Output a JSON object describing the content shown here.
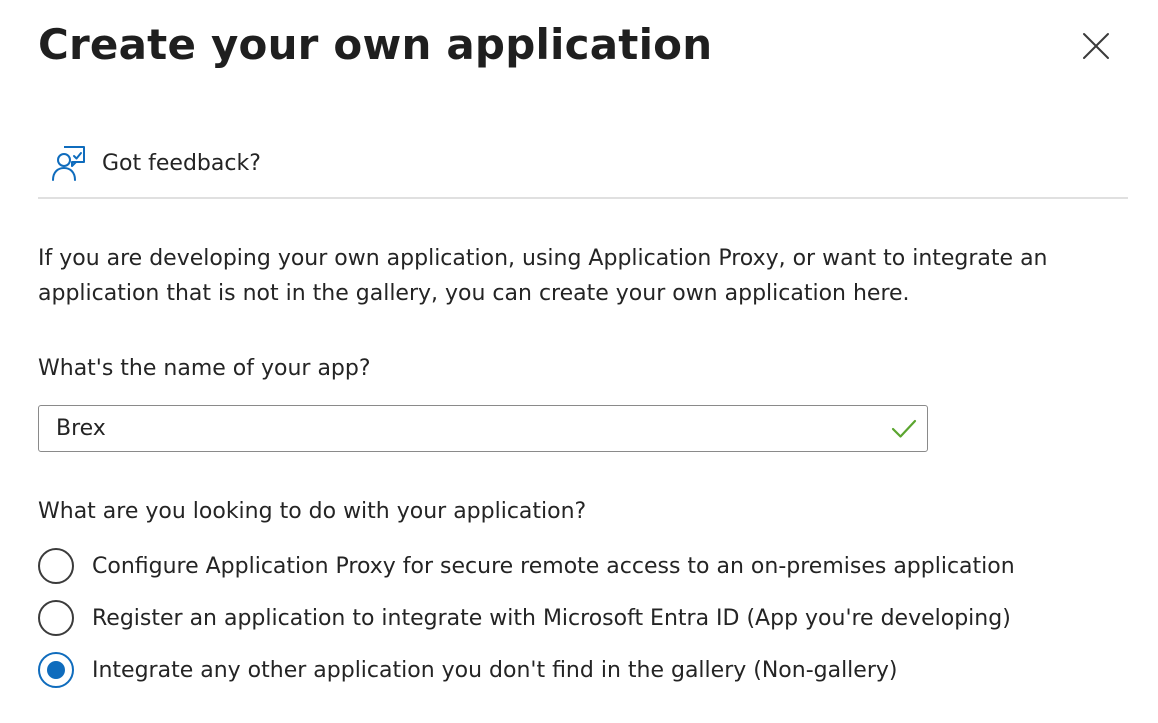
{
  "dialog": {
    "title": "Create your own application",
    "close_icon": "close-icon"
  },
  "feedback": {
    "icon": "feedback-person-icon",
    "label": "Got feedback?"
  },
  "intro_text": "If you are developing your own application, using Application Proxy, or want to integrate an application that is not in the gallery, you can create your own application here.",
  "app_name": {
    "label": "What's the name of your app?",
    "value": "Brex",
    "valid_icon": "checkmark-icon",
    "valid_color": "#5ba52f"
  },
  "purpose": {
    "label": "What are you looking to do with your application?",
    "options": [
      {
        "label": "Configure Application Proxy for secure remote access to an on-premises application",
        "selected": false
      },
      {
        "label": "Register an application to integrate with Microsoft Entra ID (App you're developing)",
        "selected": false
      },
      {
        "label": "Integrate any other application you don't find in the gallery (Non-gallery)",
        "selected": true
      }
    ]
  },
  "colors": {
    "accent": "#0f6cbd",
    "text": "#242424",
    "divider": "#e0e0e0"
  }
}
